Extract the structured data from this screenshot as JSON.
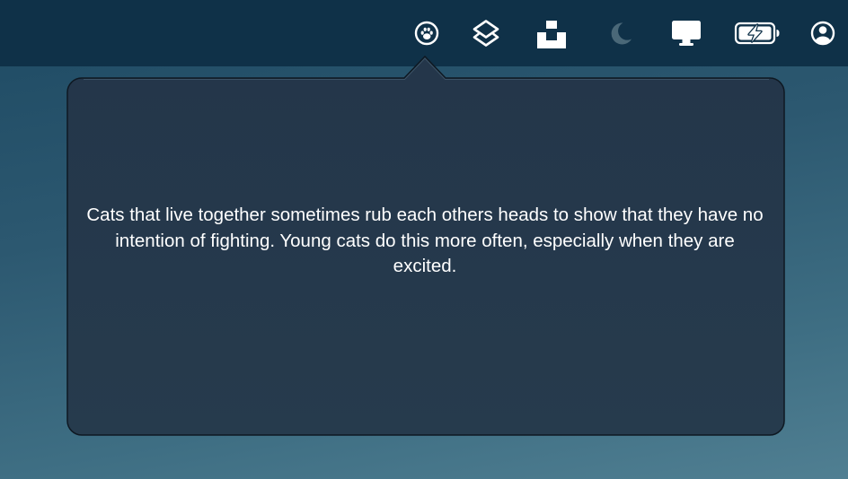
{
  "menubar": {
    "icons": [
      {
        "name": "paw-icon",
        "active": true
      },
      {
        "name": "shortcuts-icon"
      },
      {
        "name": "unsplash-icon"
      },
      {
        "name": "moon-icon",
        "dimmed": true
      },
      {
        "name": "display-icon"
      },
      {
        "name": "battery-charging-icon"
      },
      {
        "name": "user-account-icon"
      }
    ]
  },
  "popover": {
    "text": "Cats that live together sometimes rub each others heads to show that they have no intention of fighting. Young cats do this more often, especially when they are excited."
  },
  "colors": {
    "menubar": "#0f3148",
    "popover_bg": "#233548",
    "popover_border": "#0e1822",
    "icon": "#ffffff",
    "icon_dimmed": "#4a6878"
  }
}
